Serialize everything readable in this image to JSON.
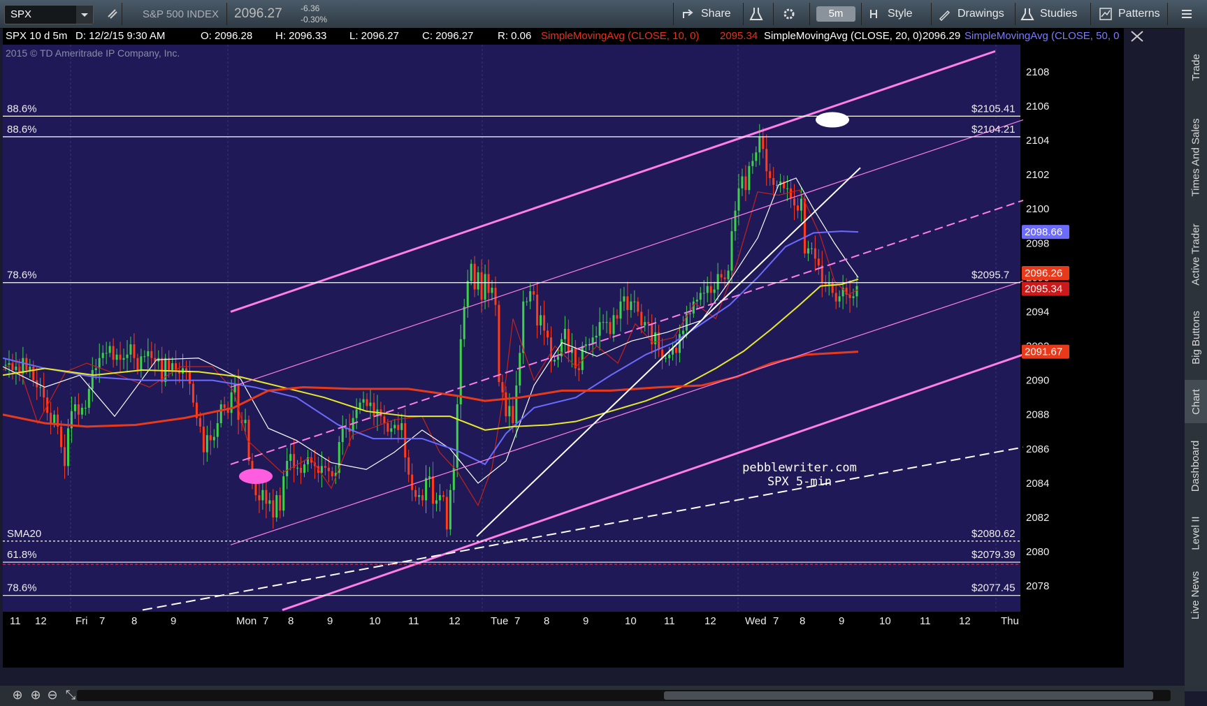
{
  "toolbar": {
    "symbol": "SPX",
    "index_name": "S&P 500 INDEX",
    "price": "2096.27",
    "change": "-6.36",
    "change_pct": "-0.30%",
    "share": "Share",
    "timeframe": "5m",
    "style": "Style",
    "drawings": "Drawings",
    "studies": "Studies",
    "patterns": "Patterns"
  },
  "infobar": {
    "title": "SPX 10 d 5m",
    "date": "D: 12/2/15 9:30 AM",
    "open": "O: 2096.28",
    "high": "H: 2096.33",
    "low": "L: 2096.27",
    "close": "C: 2096.27",
    "range": "R: 0.06",
    "sma10_label": "SimpleMovingAvg (CLOSE, 10, 0)",
    "sma10_val": "2095.34",
    "sma20_label": "SimpleMovingAvg (CLOSE, 20, 0)",
    "sma20_val": "2096.29",
    "sma50_label": "SimpleMovingAvg (CLOSE, 50, 0)"
  },
  "copyright": "2015 © TD Ameritrade IP Company, Inc.",
  "watermark": {
    "line1": "pebblewriter.com",
    "line2": "SPX 5-min"
  },
  "sidebar_tabs": [
    "Trade",
    "Times And Sales",
    "Active Trader",
    "Big Buttons",
    "Chart",
    "Dashboard",
    "Level II",
    "Live News"
  ],
  "chart_data": {
    "type": "candlestick",
    "ylim": [
      2076.5,
      2109.5
    ],
    "y_ticks": [
      2078,
      2080,
      2082,
      2084,
      2086,
      2088,
      2090,
      2092,
      2094,
      2096,
      2098,
      2100,
      2102,
      2104,
      2106,
      2108
    ],
    "x_labels": [
      "11",
      "12",
      "Fri",
      "7",
      "8",
      "9",
      "Mon",
      "7",
      "8",
      "9",
      "10",
      "11",
      "12",
      "Tue",
      "7",
      "8",
      "9",
      "10",
      "11",
      "12",
      "Wed",
      "7",
      "8",
      "9",
      "10",
      "11",
      "12",
      "Thu"
    ],
    "horizontal_levels": [
      {
        "left_label": "88.6%",
        "right_label": "$2105.41",
        "value": 2105.41,
        "style": "solid",
        "color": "#ffffff"
      },
      {
        "left_label": "88.6%",
        "right_label": "$2104.21",
        "value": 2104.21,
        "style": "solid",
        "color": "#ffffff"
      },
      {
        "left_label": "78.6%",
        "right_label": "$2095.7",
        "value": 2095.7,
        "style": "solid",
        "color": "#ffffff"
      },
      {
        "left_label": "SMA20",
        "right_label": "$2080.62",
        "value": 2080.62,
        "style": "dotted",
        "color": "#ffffff"
      },
      {
        "left_label": "61.8%",
        "right_label": "$2079.39",
        "value": 2079.39,
        "style": "solid-red",
        "color": "#ffffff"
      },
      {
        "left_label": "78.6%",
        "right_label": "$2077.45",
        "value": 2077.45,
        "style": "solid",
        "color": "#ffffff"
      }
    ],
    "price_badges": [
      {
        "text": "2098.66",
        "value": 2098.66,
        "color": "#6b6bff"
      },
      {
        "text": "2096.26",
        "value": 2096.26,
        "color": "#e83a1a"
      },
      {
        "text": "2095.34",
        "value": 2095.34,
        "color": "#cc1a1a"
      },
      {
        "text": "2091.67",
        "value": 2091.67,
        "color": "#e83a1a"
      }
    ],
    "closes": [
      2090.9,
      2091.0,
      2090.6,
      2090.8,
      2090.4,
      2091.3,
      2090.6,
      2090.8,
      2090.0,
      2089.6,
      2089.6,
      2089.0,
      2088.1,
      2087.5,
      2088.0,
      2087.3,
      2086.1,
      2085.0,
      2087.2,
      2088.2,
      2088.6,
      2088.0,
      2088.4,
      2088.4,
      2089.5,
      2090.6,
      2090.7,
      2091.3,
      2091.6,
      2091.6,
      2092.0,
      2091.2,
      2091.5,
      2091.2,
      2091.3,
      2091.5,
      2092.1,
      2091.3,
      2090.6,
      2091.4,
      2091.4,
      2091.7,
      2091.3,
      2091.1,
      2091.3,
      2089.9,
      2091.3,
      2090.6,
      2091.0,
      2090.5,
      2090.4,
      2090.7,
      2090.5,
      2089.8,
      2088.7,
      2087.8,
      2087.3,
      2085.8,
      2086.8,
      2086.5,
      2086.7,
      2087.5,
      2088.6,
      2088.4,
      2088.1,
      2089.3,
      2089.8,
      2087.7,
      2087.5,
      2087.7,
      2085.3,
      2084.1,
      2083.3,
      2083.0,
      2083.6,
      2082.8,
      2083.0,
      2082.0,
      2083.3,
      2082.4,
      2084.4,
      2085.3,
      2085.7,
      2084.9,
      2084.9,
      2084.6,
      2085.1,
      2085.5,
      2085.2,
      2085.0,
      2084.6,
      2085.0,
      2084.9,
      2084.7,
      2084.4,
      2084.6,
      2086.4,
      2087.2,
      2087.2,
      2087.0,
      2087.8,
      2088.3,
      2088.7,
      2088.9,
      2088.5,
      2088.7,
      2087.9,
      2088.3,
      2087.9,
      2087.5,
      2087.0,
      2087.2,
      2087.4,
      2087.1,
      2087.5,
      2085.5,
      2084.5,
      2083.6,
      2083.2,
      2083.3,
      2083.0,
      2084.3,
      2084.4,
      2082.8,
      2083.0,
      2083.3,
      2083.2,
      2081.3,
      2083.6,
      2084.9,
      2088.6,
      2092.4,
      2094.3,
      2095.8,
      2096.8,
      2095.3,
      2096.3,
      2094.7,
      2096.2,
      2095.1,
      2095.4,
      2094.4,
      2089.9,
      2089.3,
      2087.9,
      2088.5,
      2087.5,
      2089.7,
      2091.6,
      2094.6,
      2094.6,
      2095.2,
      2095.0,
      2093.2,
      2093.8,
      2092.9,
      2092.5,
      2091.1,
      2091.2,
      2091.4,
      2092.4,
      2093.0,
      2091.6,
      2091.9,
      2090.7,
      2090.6,
      2092.0,
      2092.1,
      2092.1,
      2092.5,
      2092.6,
      2093.4,
      2093.4,
      2093.4,
      2092.7,
      2093.8,
      2093.6,
      2094.6,
      2094.9,
      2094.1,
      2094.6,
      2094.6,
      2094.0,
      2093.2,
      2093.4,
      2093.3,
      2092.1,
      2092.8,
      2091.8,
      2091.3,
      2091.3,
      2091.5,
      2091.9,
      2091.6,
      2092.7,
      2092.9,
      2093.9,
      2093.9,
      2094.6,
      2094.7,
      2095.1,
      2095.1,
      2095.5,
      2095.1,
      2095.3,
      2096.2,
      2096.0,
      2095.9,
      2096.4,
      2098.7,
      2099.9,
      2101.2,
      2101.9,
      2101.1,
      2102.5,
      2102.8,
      2103.3,
      2104.2,
      2103.5,
      2102.2,
      2101.8,
      2101.4,
      2101.4,
      2101.6,
      2101.2,
      2101.2,
      2100.6,
      2100.2,
      2099.9,
      2100.6,
      2097.4,
      2097.7,
      2097.7,
      2097.1,
      2096.7,
      2095.7,
      2095.6,
      2095.7,
      2095.1,
      2094.6,
      2094.9,
      2095.4,
      2095.0,
      2094.8,
      2094.9,
      2095.5
    ],
    "candle_offsets": [
      2,
      6,
      4,
      7,
      3,
      5,
      1,
      3
    ],
    "series": [
      {
        "name": "SMA10",
        "color": "#c8201a",
        "points": [
          [
            0,
            2090.6
          ],
          [
            20,
            2091.2
          ],
          [
            50,
            2087.5
          ],
          [
            90,
            2090.5
          ],
          [
            120,
            2091.0
          ],
          [
            160,
            2090.4
          ],
          [
            210,
            2089.6
          ],
          [
            255,
            2090.8
          ],
          [
            300,
            2090.8
          ],
          [
            330,
            2089.4
          ],
          [
            350,
            2086.5
          ],
          [
            400,
            2084.6
          ],
          [
            440,
            2085.5
          ],
          [
            470,
            2083.7
          ],
          [
            500,
            2086.8
          ],
          [
            560,
            2087.7
          ],
          [
            600,
            2087.9
          ],
          [
            625,
            2085.8
          ],
          [
            650,
            2084.7
          ],
          [
            680,
            2082.7
          ],
          [
            700,
            2084.9
          ],
          [
            720,
            2090.1
          ],
          [
            730,
            2093.6
          ],
          [
            760,
            2090.0
          ],
          [
            790,
            2092.0
          ],
          [
            820,
            2090.8
          ],
          [
            850,
            2092.0
          ],
          [
            880,
            2091.0
          ],
          [
            905,
            2093.3
          ],
          [
            930,
            2092.2
          ],
          [
            960,
            2092.5
          ],
          [
            990,
            2094.5
          ],
          [
            1020,
            2093.6
          ],
          [
            1050,
            2096.8
          ],
          [
            1080,
            2101.0
          ],
          [
            1110,
            2100.8
          ],
          [
            1140,
            2101.1
          ],
          [
            1170,
            2098.4
          ],
          [
            1190,
            2095.8
          ],
          [
            1210,
            2095.0
          ],
          [
            1224,
            2095.3
          ]
        ]
      },
      {
        "name": "SMA20",
        "color": "#ffffff",
        "points": [
          [
            0,
            2090.8
          ],
          [
            60,
            2089.6
          ],
          [
            110,
            2090.3
          ],
          [
            160,
            2087.9
          ],
          [
            220,
            2091.2
          ],
          [
            280,
            2091.3
          ],
          [
            340,
            2090.1
          ],
          [
            380,
            2087.2
          ],
          [
            420,
            2086.5
          ],
          [
            470,
            2085.2
          ],
          [
            520,
            2084.8
          ],
          [
            560,
            2085.8
          ],
          [
            600,
            2087.1
          ],
          [
            640,
            2086.0
          ],
          [
            680,
            2084.0
          ],
          [
            720,
            2085.3
          ],
          [
            760,
            2089.7
          ],
          [
            800,
            2092.2
          ],
          [
            850,
            2091.4
          ],
          [
            900,
            2092.3
          ],
          [
            950,
            2092.8
          ],
          [
            1000,
            2093.5
          ],
          [
            1040,
            2095.8
          ],
          [
            1080,
            2098.3
          ],
          [
            1110,
            2101.4
          ],
          [
            1135,
            2101.8
          ],
          [
            1160,
            2100.0
          ],
          [
            1190,
            2098.0
          ],
          [
            1210,
            2096.8
          ],
          [
            1224,
            2096.0
          ]
        ]
      },
      {
        "name": "SMA50",
        "color": "#6b6bff",
        "points": [
          [
            0,
            2091.3
          ],
          [
            60,
            2090.7
          ],
          [
            130,
            2090.2
          ],
          [
            200,
            2090.0
          ],
          [
            300,
            2090.0
          ],
          [
            360,
            2089.6
          ],
          [
            420,
            2089.0
          ],
          [
            480,
            2087.4
          ],
          [
            530,
            2086.6
          ],
          [
            600,
            2086.6
          ],
          [
            650,
            2085.9
          ],
          [
            690,
            2085.1
          ],
          [
            720,
            2086.9
          ],
          [
            760,
            2088.4
          ],
          [
            820,
            2089.0
          ],
          [
            870,
            2090.3
          ],
          [
            920,
            2091.5
          ],
          [
            960,
            2092.2
          ],
          [
            1000,
            2093.3
          ],
          [
            1040,
            2094.4
          ],
          [
            1080,
            2096.0
          ],
          [
            1120,
            2097.8
          ],
          [
            1160,
            2098.6
          ],
          [
            1200,
            2098.7
          ],
          [
            1224,
            2098.66
          ]
        ]
      },
      {
        "name": "SMA 100",
        "color": "#e8e82a",
        "points": [
          [
            0,
            2090.3
          ],
          [
            60,
            2090.7
          ],
          [
            130,
            2090.3
          ],
          [
            200,
            2090.6
          ],
          [
            280,
            2090.5
          ],
          [
            340,
            2090.2
          ],
          [
            400,
            2089.6
          ],
          [
            460,
            2089.0
          ],
          [
            520,
            2088.2
          ],
          [
            580,
            2087.9
          ],
          [
            640,
            2087.9
          ],
          [
            690,
            2087.1
          ],
          [
            730,
            2087.3
          ],
          [
            780,
            2087.4
          ],
          [
            820,
            2087.6
          ],
          [
            870,
            2088.2
          ],
          [
            920,
            2088.8
          ],
          [
            970,
            2089.6
          ],
          [
            1020,
            2090.7
          ],
          [
            1060,
            2091.7
          ],
          [
            1100,
            2093.0
          ],
          [
            1140,
            2094.4
          ],
          [
            1170,
            2095.5
          ],
          [
            1200,
            2095.6
          ],
          [
            1224,
            2095.9
          ]
        ]
      },
      {
        "name": "SMA 200",
        "color": "#e83a1a",
        "points": [
          [
            0,
            2088.0
          ],
          [
            60,
            2087.5
          ],
          [
            120,
            2087.3
          ],
          [
            190,
            2087.4
          ],
          [
            260,
            2087.8
          ],
          [
            330,
            2088.4
          ],
          [
            380,
            2089.4
          ],
          [
            430,
            2089.6
          ],
          [
            500,
            2089.5
          ],
          [
            580,
            2089.5
          ],
          [
            650,
            2089.1
          ],
          [
            690,
            2088.8
          ],
          [
            740,
            2089.0
          ],
          [
            800,
            2089.4
          ],
          [
            870,
            2089.4
          ],
          [
            940,
            2089.6
          ],
          [
            1000,
            2089.7
          ],
          [
            1050,
            2090.2
          ],
          [
            1100,
            2091.0
          ],
          [
            1150,
            2091.5
          ],
          [
            1224,
            2091.67
          ]
        ]
      },
      {
        "name": "Channel upper",
        "color": "#ff7ee8",
        "points": [
          [
            326,
            2094.0
          ],
          [
            1420,
            2109.2
          ]
        ]
      },
      {
        "name": "Channel mid",
        "color": "#ff7ee8",
        "points": [
          [
            326,
            2085.1
          ],
          [
            1460,
            2100.5
          ]
        ]
      },
      {
        "name": "Channel lower",
        "color": "#ff7ee8",
        "points": [
          [
            400,
            2076.6
          ],
          [
            1460,
            2091.5
          ]
        ]
      },
      {
        "name": "Channel upper inner",
        "color": "#ff7ee8",
        "points": [
          [
            326,
            2089.6
          ],
          [
            1460,
            2105.2
          ]
        ]
      },
      {
        "name": "Channel lower inner",
        "color": "#ff7ee8",
        "points": [
          [
            326,
            2080.4
          ],
          [
            1460,
            2095.8
          ]
        ]
      },
      {
        "name": "Trend line",
        "color": "#ffffff",
        "points": [
          [
            678,
            2080.9
          ],
          [
            1227,
            2102.4
          ]
        ]
      },
      {
        "name": "Lower dashed",
        "color": "#ffffff",
        "points": [
          [
            200,
            2076.6
          ],
          [
            1460,
            2086.1
          ]
        ]
      }
    ],
    "markers": [
      {
        "x": 362,
        "y": 2084.4,
        "color": "#ff5de0"
      },
      {
        "x": 1187,
        "y": 2105.2,
        "color": "#ffffff"
      }
    ]
  }
}
